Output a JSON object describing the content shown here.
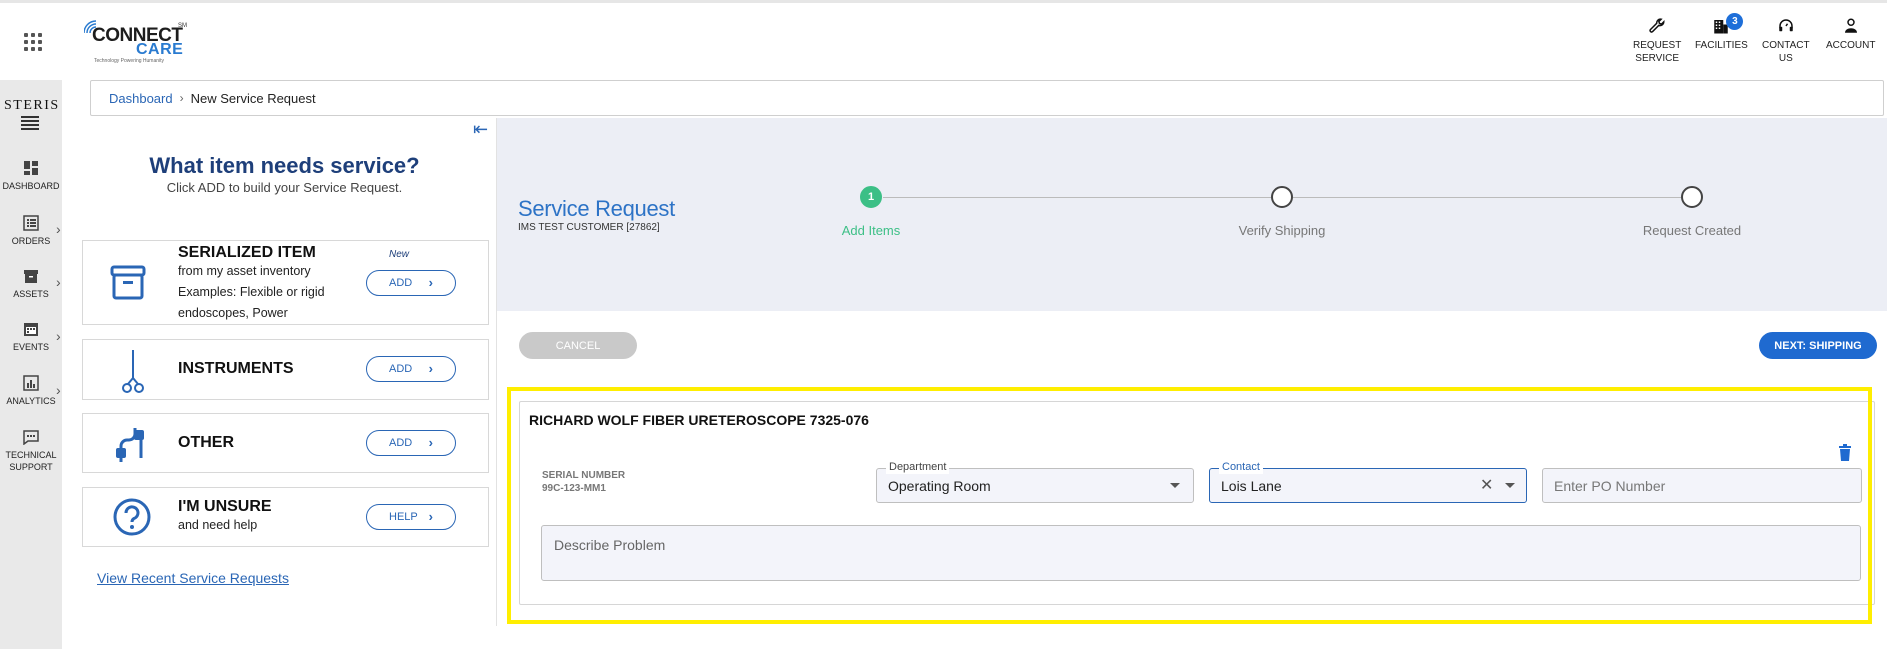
{
  "header": {
    "logo_word1": "CONNECT",
    "logo_word2": "CARE",
    "logo_tm": "SM",
    "logo_tagline": "Technology Powering Humanity",
    "nav": [
      {
        "label": "REQUEST\nSERVICE",
        "icon": "wrench-icon"
      },
      {
        "label": "FACILITIES",
        "icon": "building-icon",
        "badge": "3"
      },
      {
        "label": "CONTACT\nUS",
        "icon": "headset-icon"
      },
      {
        "label": "ACCOUNT",
        "icon": "person-icon"
      }
    ]
  },
  "rail": {
    "brand": "STERIS",
    "items": [
      {
        "label": "DASHBOARD",
        "icon": "dashboard-icon"
      },
      {
        "label": "ORDERS",
        "icon": "orders-icon"
      },
      {
        "label": "ASSETS",
        "icon": "assets-icon"
      },
      {
        "label": "EVENTS",
        "icon": "calendar-icon"
      },
      {
        "label": "ANALYTICS",
        "icon": "analytics-icon"
      },
      {
        "label": "TECHNICAL\nSUPPORT",
        "icon": "chat-icon"
      }
    ]
  },
  "breadcrumb": {
    "root": "Dashboard",
    "current": "New Service Request"
  },
  "left_panel": {
    "title": "What item needs service?",
    "subtitle": "Click ADD to build your Service Request.",
    "cards": [
      {
        "title": "SERIALIZED ITEM",
        "desc1": "from my asset inventory",
        "desc2": "Examples: Flexible or rigid",
        "desc3": "endoscopes, Power",
        "new": "New",
        "button": "ADD"
      },
      {
        "title": "INSTRUMENTS",
        "button": "ADD"
      },
      {
        "title": "OTHER",
        "button": "ADD"
      },
      {
        "title": "I'M UNSURE",
        "desc1": "and need help",
        "button": "HELP"
      }
    ],
    "recent_link": "View Recent Service Requests"
  },
  "service_request": {
    "title": "Service Request",
    "customer": "IMS TEST CUSTOMER [27862]",
    "steps": [
      {
        "number": "1",
        "label": "Add Items",
        "active": true
      },
      {
        "label": "Verify Shipping",
        "active": false
      },
      {
        "label": "Request Created",
        "active": false
      }
    ],
    "cancel_label": "CANCEL",
    "next_label": "NEXT: SHIPPING"
  },
  "item": {
    "title": "RICHARD WOLF FIBER URETEROSCOPE 7325-076",
    "serial_label": "SERIAL NUMBER",
    "serial_value": "99C-123-MM1",
    "department_label": "Department",
    "department_value": "Operating Room",
    "contact_label": "Contact",
    "contact_value": "Lois Lane",
    "po_placeholder": "Enter PO Number",
    "describe_placeholder": "Describe Problem"
  },
  "colors": {
    "accent": "#1f6ad0",
    "step_active": "#3cbf86",
    "highlight": "#ffee00",
    "title_navy": "#1e3f7a"
  }
}
